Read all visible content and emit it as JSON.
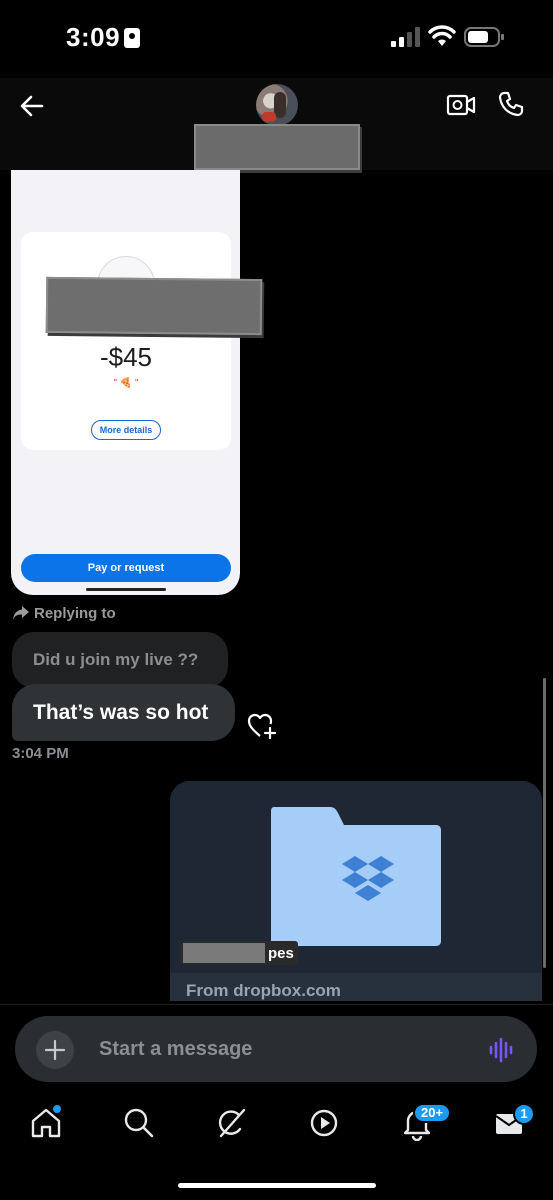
{
  "status_bar": {
    "time": "3:09"
  },
  "header": {
    "back_icon": "back-arrow-icon",
    "call_icons": [
      "video-call-icon",
      "phone-icon"
    ]
  },
  "shared_image": {
    "amount": "-$45",
    "emoji": "\" 🍕 \"",
    "more_details": "More details",
    "pay_request": "Pay or request"
  },
  "reply": {
    "label": "Replying to"
  },
  "quoted_message": "Did u join my live ??",
  "message": {
    "text": "That’s was so hot",
    "time": "3:04 PM"
  },
  "link_card": {
    "title_suffix": "pes",
    "domain": "From dropbox.com"
  },
  "composer": {
    "placeholder": "Start a message"
  },
  "nav": {
    "items": [
      "home-icon",
      "search-icon",
      "grok-icon",
      "video-icon",
      "notifications-icon",
      "messages-icon"
    ],
    "notifications_badge": "20+",
    "messages_badge": "1"
  },
  "colors": {
    "accent": "#1d9bf0",
    "background": "#000000",
    "bubble": "#2f3336",
    "voice": "#7856ff"
  }
}
